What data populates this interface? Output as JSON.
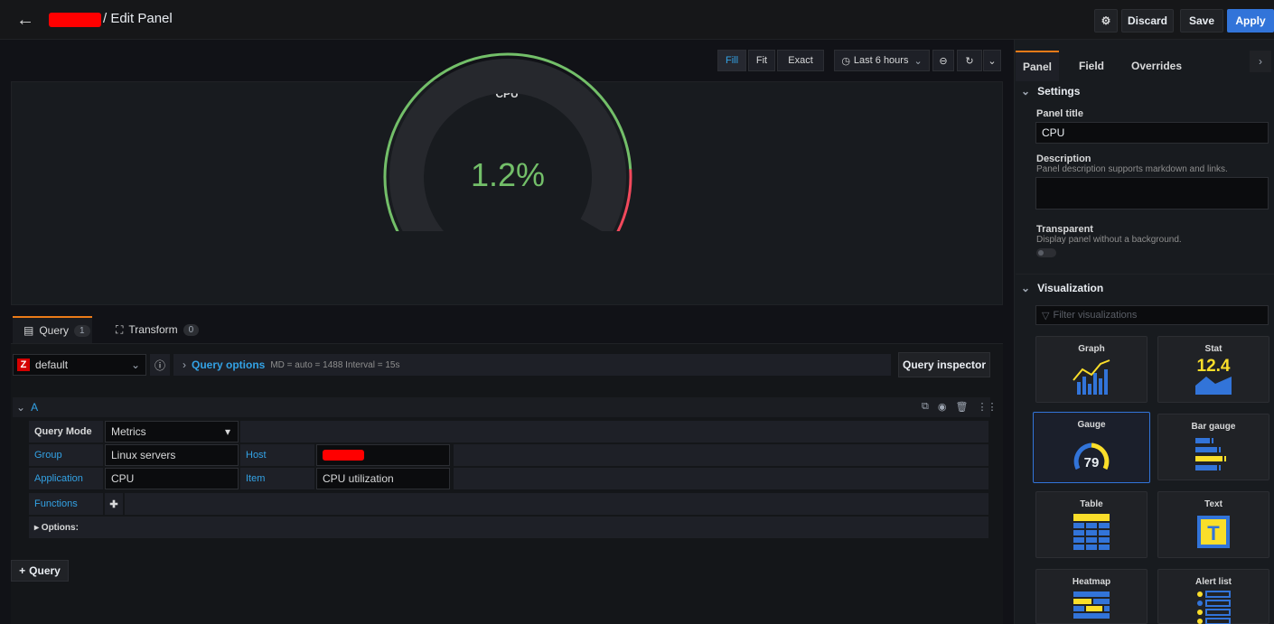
{
  "topbar": {
    "title": "/ Edit Panel",
    "discard_label": "Discard",
    "save_label": "Save",
    "apply_label": "Apply"
  },
  "toolbar": {
    "fill_label": "Fill",
    "fit_label": "Fit",
    "exact_label": "Exact",
    "time_range": "Last 6 hours"
  },
  "panel": {
    "title": "CPU",
    "value_text": "1.2%",
    "value_fraction": 0.012
  },
  "tabs": {
    "query_label": "Query",
    "query_count": "1",
    "transform_label": "Transform",
    "transform_count": "0"
  },
  "datasource": {
    "logo": "Z",
    "name": "default",
    "query_options_label": "Query options",
    "query_options_meta": "MD = auto = 1488   Interval = 15s",
    "inspector_label": "Query inspector"
  },
  "query_a": {
    "ref": "A",
    "mode_label": "Query Mode",
    "mode_value": "Metrics",
    "group_label": "Group",
    "group_value": "Linux servers",
    "host_label": "Host",
    "application_label": "Application",
    "application_value": "CPU",
    "item_label": "Item",
    "item_value": "CPU utilization",
    "functions_label": "Functions",
    "options_label": "▸ Options:"
  },
  "add_query_label": "Query",
  "sidebar": {
    "tabs": [
      "Panel",
      "Field",
      "Overrides"
    ],
    "settings_title": "Settings",
    "panel_title_label": "Panel title",
    "panel_title_value": "CPU",
    "description_label": "Description",
    "description_hint": "Panel description supports markdown and links.",
    "transparent_label": "Transparent",
    "transparent_hint": "Display panel without a background.",
    "visualization_title": "Visualization",
    "filter_placeholder": "Filter visualizations",
    "cards": [
      {
        "title": "Graph",
        "icon": "graph-icon"
      },
      {
        "title": "Stat",
        "icon": "stat-icon",
        "icon_text": "12.4"
      },
      {
        "title": "Gauge",
        "icon": "gauge-icon",
        "icon_text": "79",
        "selected": true
      },
      {
        "title": "Bar gauge",
        "icon": "bar-gauge-icon"
      },
      {
        "title": "Table",
        "icon": "table-icon"
      },
      {
        "title": "Text",
        "icon": "text-icon",
        "icon_text": "T"
      },
      {
        "title": "Heatmap",
        "icon": "heatmap-icon"
      },
      {
        "title": "Alert list",
        "icon": "alert-list-icon"
      }
    ]
  },
  "colors": {
    "accent": "#3274d9",
    "tab_active": "#eb7b18",
    "link": "#33a2e5",
    "gauge_green": "#73bf69",
    "gauge_red": "#f2495c",
    "icon_blue": "#3274d9",
    "icon_yellow": "#fade2a"
  }
}
